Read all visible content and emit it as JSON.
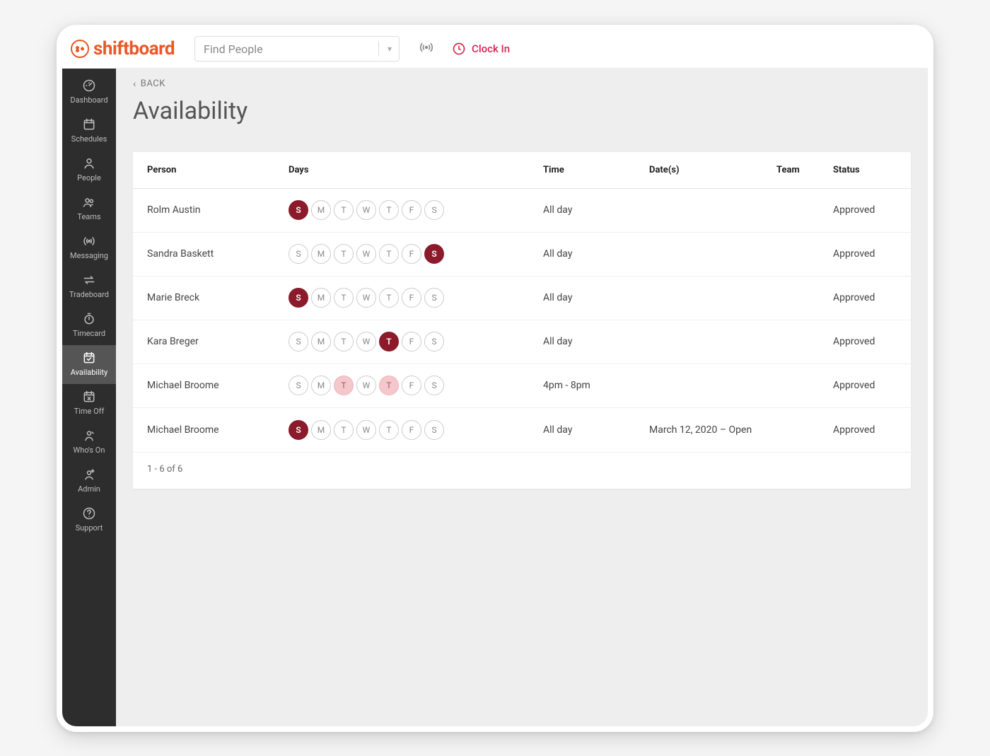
{
  "brand": "shiftboard",
  "search": {
    "placeholder": "Find People"
  },
  "clockin_label": "Clock In",
  "sidebar": {
    "items": [
      {
        "label": "Dashboard",
        "icon": "gauge"
      },
      {
        "label": "Schedules",
        "icon": "calendar"
      },
      {
        "label": "People",
        "icon": "person"
      },
      {
        "label": "Teams",
        "icon": "people"
      },
      {
        "label": "Messaging",
        "icon": "broadcast"
      },
      {
        "label": "Tradeboard",
        "icon": "swap"
      },
      {
        "label": "Timecard",
        "icon": "stopwatch"
      },
      {
        "label": "Availability",
        "icon": "cal-check",
        "active": true
      },
      {
        "label": "Time Off",
        "icon": "cal-x"
      },
      {
        "label": "Who's On",
        "icon": "person-badge"
      },
      {
        "label": "Admin",
        "icon": "admin"
      },
      {
        "label": "Support",
        "icon": "help"
      }
    ]
  },
  "back_label": "BACK",
  "page_title": "Availability",
  "columns": {
    "person": "Person",
    "days": "Days",
    "time": "Time",
    "dates": "Date(s)",
    "team": "Team",
    "status": "Status"
  },
  "day_labels": [
    "S",
    "M",
    "T",
    "W",
    "T",
    "F",
    "S"
  ],
  "rows": [
    {
      "person": "Rolm Austin",
      "days": [
        "sel",
        "",
        "",
        "",
        "",
        "",
        ""
      ],
      "time": "All day",
      "dates": "",
      "team": "",
      "status": "Approved"
    },
    {
      "person": "Sandra Baskett",
      "days": [
        "",
        "",
        "",
        "",
        "",
        "",
        "sel"
      ],
      "time": "All day",
      "dates": "",
      "team": "",
      "status": "Approved"
    },
    {
      "person": "Marie Breck",
      "days": [
        "sel",
        "",
        "",
        "",
        "",
        "",
        ""
      ],
      "time": "All day",
      "dates": "",
      "team": "",
      "status": "Approved"
    },
    {
      "person": "Kara Breger",
      "days": [
        "",
        "",
        "",
        "",
        "sel",
        "",
        ""
      ],
      "time": "All day",
      "dates": "",
      "team": "",
      "status": "Approved"
    },
    {
      "person": "Michael Broome",
      "days": [
        "",
        "",
        "soft",
        "",
        "soft",
        "",
        ""
      ],
      "time": "4pm - 8pm",
      "dates": "",
      "team": "",
      "status": "Approved"
    },
    {
      "person": "Michael Broome",
      "days": [
        "sel",
        "",
        "",
        "",
        "",
        "",
        ""
      ],
      "time": "All day",
      "dates": "March 12, 2020 – Open",
      "team": "",
      "status": "Approved"
    }
  ],
  "pagination": "1 - 6 of 6"
}
